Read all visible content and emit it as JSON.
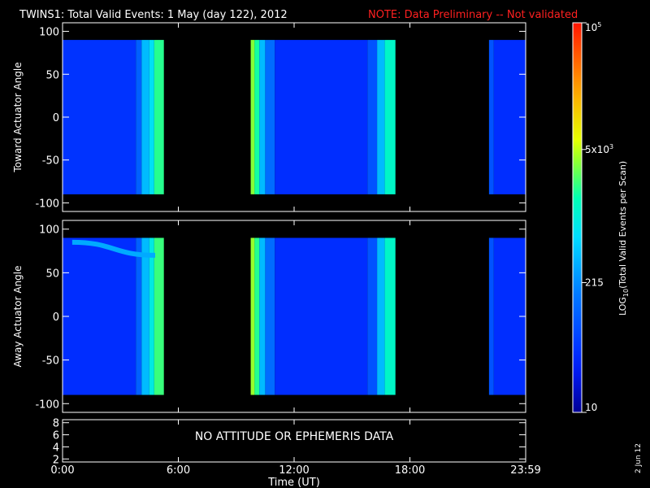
{
  "title": "TWINS1: Total Valid Events:  1 May (day 122), 2012",
  "title_note": "NOTE: Data Preliminary -- Not validated",
  "date_stamp": "2 Jun 12",
  "no_data_message": "NO ATTITUDE OR EPHEMERIS DATA",
  "colors": {
    "background": "#000000",
    "axis": "#ffffff",
    "note": "#ff2020"
  },
  "chart_data": [
    {
      "type": "heatmap",
      "panel": "top",
      "ylabel": "Toward Actuator Angle",
      "ylim": [
        -110,
        110
      ],
      "yticks": [
        "100",
        "50",
        "0",
        "-50",
        "-100"
      ],
      "ytick_values": [
        100,
        50,
        0,
        -50,
        -100
      ],
      "xlim_hours": [
        0,
        24
      ],
      "data_y_range": [
        -90,
        90
      ],
      "segments": [
        {
          "start_hour": 0.0,
          "end_hour": 5.25,
          "bands": [
            {
              "start": 0.0,
              "end": 3.8,
              "log_value": 1.65
            },
            {
              "start": 3.8,
              "end": 4.1,
              "log_value": 2.0
            },
            {
              "start": 4.1,
              "end": 4.5,
              "log_value": 2.6
            },
            {
              "start": 4.5,
              "end": 4.75,
              "log_value": 2.85
            },
            {
              "start": 4.75,
              "end": 5.25,
              "log_value": 3.3
            }
          ]
        },
        {
          "start_hour": 9.75,
          "end_hour": 17.25,
          "bands": [
            {
              "start": 9.75,
              "end": 9.95,
              "log_value": 3.55
            },
            {
              "start": 9.95,
              "end": 10.2,
              "log_value": 3.25
            },
            {
              "start": 10.2,
              "end": 10.5,
              "log_value": 2.6
            },
            {
              "start": 10.5,
              "end": 11.0,
              "log_value": 2.1
            },
            {
              "start": 11.0,
              "end": 15.8,
              "log_value": 1.6
            },
            {
              "start": 15.8,
              "end": 16.3,
              "log_value": 1.9
            },
            {
              "start": 16.3,
              "end": 16.7,
              "log_value": 2.6
            },
            {
              "start": 16.7,
              "end": 17.25,
              "log_value": 3.1
            }
          ]
        },
        {
          "start_hour": 22.1,
          "end_hour": 24.0,
          "bands": [
            {
              "start": 22.1,
              "end": 22.35,
              "log_value": 1.9
            },
            {
              "start": 22.35,
              "end": 24.0,
              "log_value": 1.6
            }
          ]
        }
      ]
    },
    {
      "type": "heatmap",
      "panel": "middle",
      "ylabel": "Away Actuator Angle",
      "ylim": [
        -110,
        110
      ],
      "yticks": [
        "100",
        "50",
        "0",
        "-50",
        "-100"
      ],
      "ytick_values": [
        100,
        50,
        0,
        -50,
        -100
      ],
      "xlim_hours": [
        0,
        24
      ],
      "data_y_range": [
        -90,
        90
      ],
      "segments": [
        {
          "start_hour": 0.0,
          "end_hour": 5.25,
          "bands": [
            {
              "start": 0.0,
              "end": 3.8,
              "log_value": 1.6
            },
            {
              "start": 3.8,
              "end": 4.1,
              "log_value": 2.0
            },
            {
              "start": 4.1,
              "end": 4.5,
              "log_value": 2.6
            },
            {
              "start": 4.5,
              "end": 4.75,
              "log_value": 2.95
            },
            {
              "start": 4.75,
              "end": 5.25,
              "log_value": 3.35
            }
          ]
        },
        {
          "start_hour": 9.75,
          "end_hour": 17.25,
          "bands": [
            {
              "start": 9.75,
              "end": 9.95,
              "log_value": 3.6
            },
            {
              "start": 9.95,
              "end": 10.2,
              "log_value": 3.3
            },
            {
              "start": 10.2,
              "end": 10.5,
              "log_value": 2.6
            },
            {
              "start": 10.5,
              "end": 11.0,
              "log_value": 2.1
            },
            {
              "start": 11.0,
              "end": 15.8,
              "log_value": 1.6
            },
            {
              "start": 15.8,
              "end": 16.3,
              "log_value": 1.9
            },
            {
              "start": 16.3,
              "end": 16.7,
              "log_value": 2.6
            },
            {
              "start": 16.7,
              "end": 17.25,
              "log_value": 3.1
            }
          ]
        },
        {
          "start_hour": 22.1,
          "end_hour": 24.0,
          "bands": [
            {
              "start": 22.1,
              "end": 22.35,
              "log_value": 1.9
            },
            {
              "start": 22.35,
              "end": 24.0,
              "log_value": 1.6
            }
          ]
        }
      ],
      "feature": {
        "start_hour": 0.5,
        "end_hour": 4.8,
        "angle_start": 85,
        "angle_end": 70,
        "log_value": 2.5
      }
    },
    {
      "type": "line",
      "panel": "bottom",
      "ylim": [
        1.5,
        8.5
      ],
      "yticks": [
        "8",
        "6",
        "4",
        "2"
      ],
      "ytick_values": [
        8,
        6,
        4,
        2
      ],
      "values": []
    }
  ],
  "x_axis": {
    "label": "Time (UT)",
    "tick_labels": [
      "0:00",
      "6:00",
      "12:00",
      "18:00",
      "23:59"
    ],
    "tick_hours": [
      0,
      6,
      12,
      18,
      24
    ]
  },
  "colorbar": {
    "label": "LOG",
    "label_sub": "10",
    "label_rest": "(Total Valid  Events per Scan)",
    "log_min": 1,
    "log_max": 5,
    "ticks": [
      {
        "log_value": 5,
        "base": "10",
        "sup": "5"
      },
      {
        "log_value": 3.699,
        "base": "5x10",
        "sup": "3"
      },
      {
        "log_value": 2.332,
        "base": "215",
        "sup": ""
      },
      {
        "log_value": 1,
        "base": "10",
        "sup": ""
      }
    ]
  }
}
